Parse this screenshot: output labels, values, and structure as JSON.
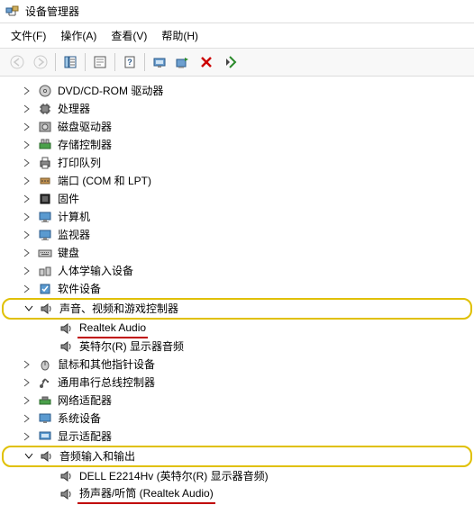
{
  "window": {
    "title": "设备管理器"
  },
  "menu": {
    "file": "文件(F)",
    "action": "操作(A)",
    "view": "查看(V)",
    "help": "帮助(H)"
  },
  "tree": {
    "dvd": "DVD/CD-ROM 驱动器",
    "cpu": "处理器",
    "disk": "磁盘驱动器",
    "storage": "存储控制器",
    "printq": "打印队列",
    "ports": "端口 (COM 和 LPT)",
    "firmware": "固件",
    "computer": "计算机",
    "monitor": "监视器",
    "keyboard": "键盘",
    "hid": "人体学输入设备",
    "soft": "软件设备",
    "sound": "声音、视频和游戏控制器",
    "realtek": "Realtek Audio",
    "intel_audio": "英特尔(R) 显示器音频",
    "mouse": "鼠标和其他指针设备",
    "usb": "通用串行总线控制器",
    "net": "网络适配器",
    "sysdev": "系统设备",
    "display": "显示适配器",
    "audio_io": "音频输入和输出",
    "dell": "DELL E2214Hv (英特尔(R) 显示器音频)",
    "speaker": "扬声器/听筒 (Realtek Audio)"
  }
}
